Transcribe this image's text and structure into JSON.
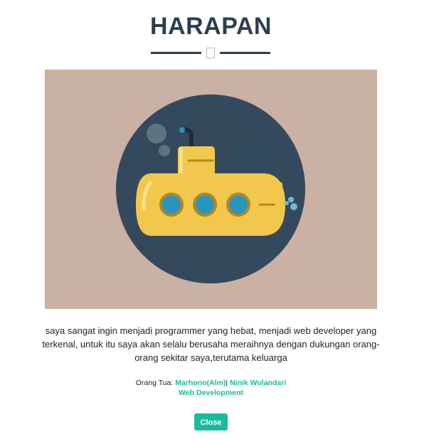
{
  "header": {
    "title": "HARAPAN"
  },
  "divider": {
    "icon": "star-icon-missing-glyph"
  },
  "image": {
    "alt_subject": "submarine-illustration",
    "colors": {
      "background": "#cbb1a4",
      "circle": "#34495e",
      "hull": "#f1c84b",
      "window": "#2a95bf",
      "accent": "#b4871f"
    }
  },
  "content": {
    "description": "saya sangat ingin menjadi programmer yang hebat, menjadi web developer yang terkenal, untuk itu saya akan selalu berusaha meraihnya dengan dukungan orang-orang sekitar saya,terutama keluarga"
  },
  "meta": {
    "parents_label": "Orang Tua:",
    "father": "Marhono(Alm)",
    "separator": "|",
    "mother": "Ninik Wulandari",
    "category": "Web Development"
  },
  "footer": {
    "close_label": "Close"
  },
  "colors": {
    "primary": "#2c3e50",
    "accent": "#18bc9c"
  }
}
